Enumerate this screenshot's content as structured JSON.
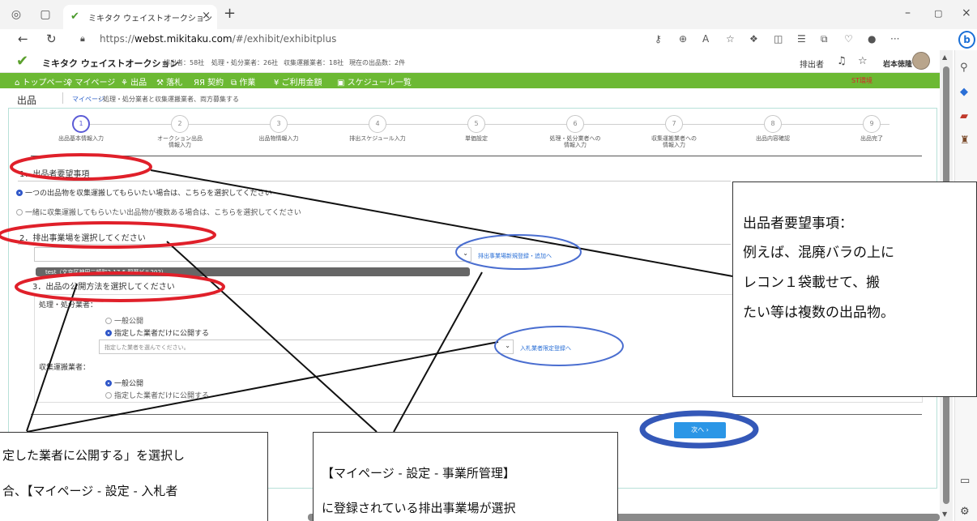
{
  "browser": {
    "tab_title": "ミキタク ウェイストオークション",
    "url_prefix": "https://",
    "url_host": "webst.mikitaku.com",
    "url_path": "/#/exhibit/exhibitplus"
  },
  "header": {
    "brand": "ミキタク ウェイストオークション",
    "stats": [
      "排出者：58社",
      "処理・処分業者：26社",
      "収集運搬業者：18社",
      "現在の出品数：2件"
    ],
    "role": "排出者",
    "user_name": "岩本徳隆"
  },
  "nav": {
    "items": [
      "⌂ トップページ",
      "♀ マイページ",
      "⚘ 出品",
      "⚒ 落札",
      "ЯЯ 契約",
      "⧉ 作業",
      "¥ ご利用金額",
      "▣ スケジュール一覧"
    ],
    "env_label": "ST環境"
  },
  "breadcrumb": {
    "page_title": "出品",
    "mypage": "マイページ",
    "path": "・処理・処分業者と収集運搬業者、両方募集する"
  },
  "steps": [
    {
      "num": "1",
      "label": "出品基本情報入力"
    },
    {
      "num": "2",
      "label": "オークション出品\n情報入力"
    },
    {
      "num": "3",
      "label": "出品物情報入力"
    },
    {
      "num": "4",
      "label": "排出スケジュール入力"
    },
    {
      "num": "5",
      "label": "単価設定"
    },
    {
      "num": "6",
      "label": "処理・処分業者への\n情報入力"
    },
    {
      "num": "7",
      "label": "収集運搬業者への\n情報入力"
    },
    {
      "num": "8",
      "label": "出品内容確認"
    },
    {
      "num": "9",
      "label": "出品完了"
    }
  ],
  "section1": {
    "title": "1．出品者要望事項",
    "opt1": "一つの出品物を収集運搬してもらいたい場合は、こちらを選択してください",
    "opt2": "一緒に収集運搬してもらいたい出品物が複数ある場合は、こちらを選択してください"
  },
  "section2": {
    "title": "2．排出事業場を選択してください",
    "link": "排出事業場新規登録・追加へ",
    "dropdown_option": "test（文京区神田三崎町2-17-5 稲葉ビル202）"
  },
  "section3": {
    "title": "3．出品の公開方法を選択してください",
    "processor_label": "処理・処分業者：",
    "public": "一般公開",
    "designated": "指定した業者だけに公開する",
    "vendor_placeholder": "指定した業者を選んでください。",
    "vendor_link": "入札業者限定登録へ",
    "collector_label": "収集運搬業者："
  },
  "next_button": "次へ ›",
  "callouts": {
    "c1": [
      "出品者要望事項：",
      "例えば、混廃バラの上に",
      "レコン１袋載せて、搬",
      "たい等は複数の出品物。"
    ],
    "c2": [
      "定した業者に公開する」を選択し",
      "合、【マイページ - 設定 - 入札者"
    ],
    "c3": [
      "【マイページ - 設定 - 事業所管理】",
      "に登録されている排出事業場が選択"
    ]
  }
}
